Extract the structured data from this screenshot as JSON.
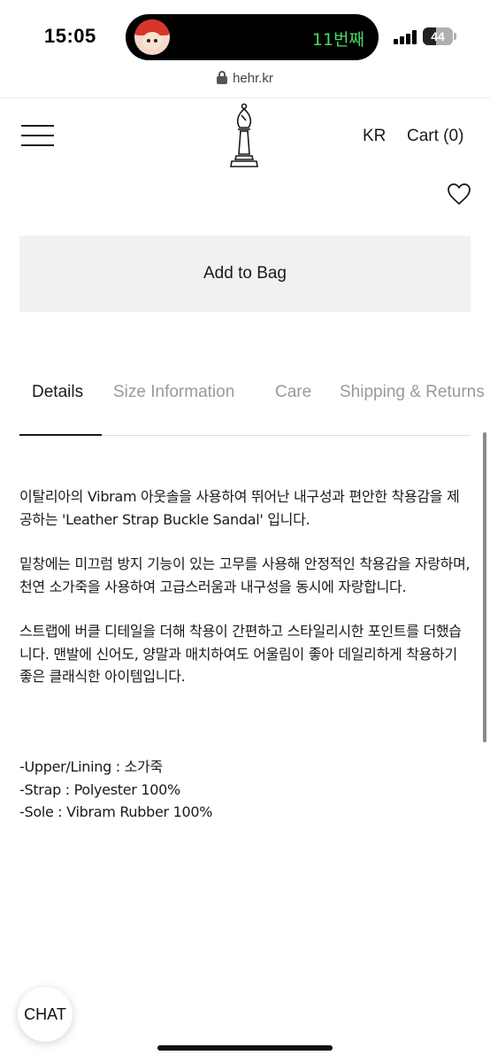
{
  "status_bar": {
    "time": "15:05",
    "island_text": "11번째",
    "battery": "44",
    "battery_level": 0.44
  },
  "browser": {
    "url": "hehr.kr"
  },
  "header": {
    "language": "KR",
    "cart": "Cart (0)"
  },
  "product": {
    "add_to_bag": "Add to Bag"
  },
  "tabs": [
    {
      "label": "Details",
      "active": true
    },
    {
      "label": "Size Information",
      "active": false
    },
    {
      "label": "Care",
      "active": false
    },
    {
      "label": "Shipping & Returns",
      "active": false
    }
  ],
  "details": {
    "paragraphs": [
      "이탈리아의 Vibram 아웃솔을 사용하여 뛰어난 내구성과 편안한 착용감을 제공하는 'Leather Strap Buckle Sandal' 입니다.",
      "밑창에는 미끄럼 방지 기능이 있는 고무를 사용해 안정적인 착용감을 자랑하며, 천연 소가죽을 사용하여 고급스러움과 내구성을 동시에 자랑합니다.",
      "스트랩에 버클 디테일을 더해 착용이 간편하고 스타일리시한 포인트를 더했습니다. 맨발에 신어도, 양말과 매치하여도 어울림이 좋아 데일리하게 착용하기 좋은 클래식한 아이템입니다."
    ],
    "specs": [
      "-Upper/Lining : 소가죽",
      "-Strap : Polyester 100%",
      "-Sole : Vibram Rubber 100%"
    ]
  },
  "chat": {
    "label": "CHAT"
  },
  "colors": {
    "text": "#1a1a1a",
    "muted_tab": "#9a9a9a",
    "button_bg": "#f1f1f1",
    "island_text": "#4cd964"
  }
}
